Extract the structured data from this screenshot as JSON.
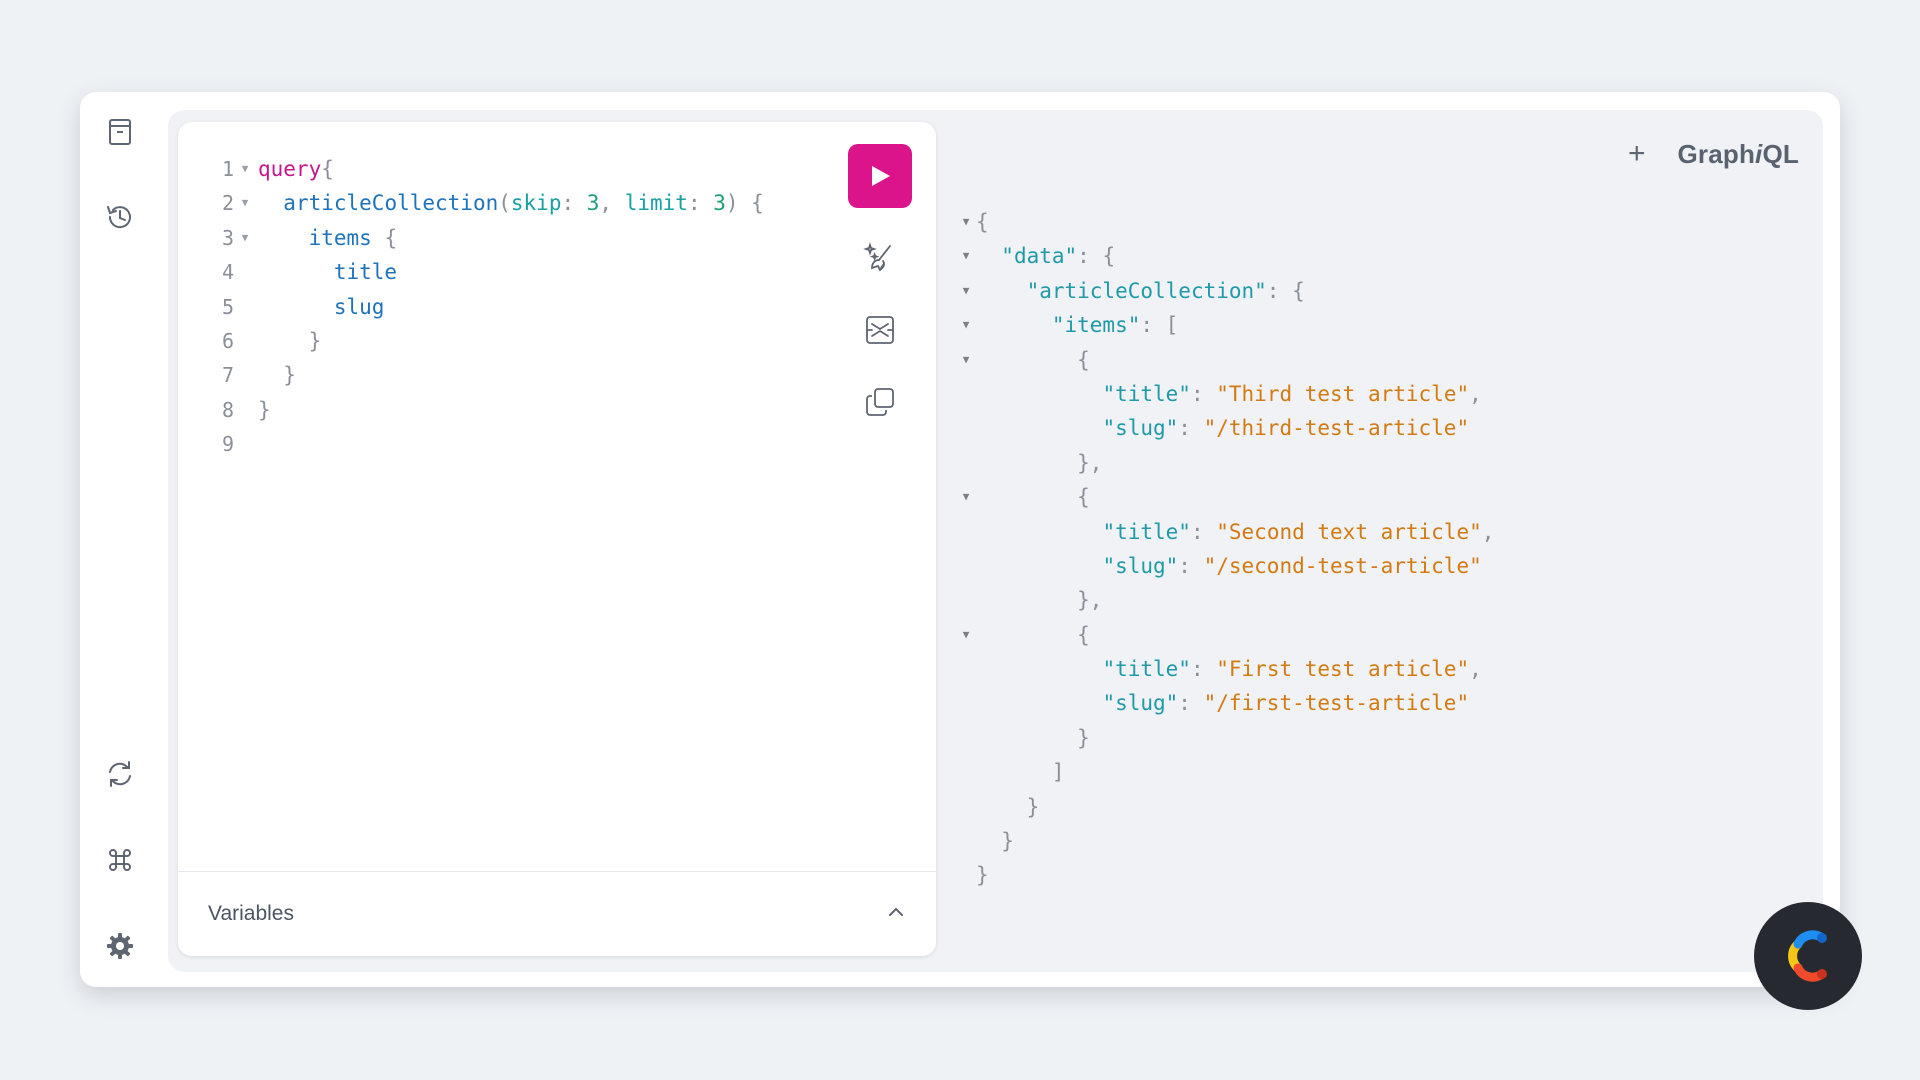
{
  "app": {
    "logo_prefix": "Graph",
    "logo_italic": "i",
    "logo_suffix": "QL",
    "add_tab_label": "+"
  },
  "editor": {
    "lines": [
      {
        "n": "1",
        "fold": true,
        "tokens": [
          [
            "kw",
            "query"
          ],
          [
            "pn",
            "{"
          ]
        ]
      },
      {
        "n": "2",
        "fold": true,
        "tokens": [
          [
            "sp",
            "  "
          ],
          [
            "fn",
            "articleCollection"
          ],
          [
            "pn",
            "("
          ],
          [
            "arg",
            "skip"
          ],
          [
            "pn",
            ": "
          ],
          [
            "num",
            "3"
          ],
          [
            "pn",
            ", "
          ],
          [
            "arg",
            "limit"
          ],
          [
            "pn",
            ": "
          ],
          [
            "num",
            "3"
          ],
          [
            "pn",
            ") {"
          ]
        ]
      },
      {
        "n": "3",
        "fold": true,
        "tokens": [
          [
            "sp",
            "    "
          ],
          [
            "field",
            "items"
          ],
          [
            "pn",
            " {"
          ]
        ]
      },
      {
        "n": "4",
        "fold": false,
        "tokens": [
          [
            "sp",
            "      "
          ],
          [
            "field",
            "title"
          ]
        ]
      },
      {
        "n": "5",
        "fold": false,
        "tokens": [
          [
            "sp",
            "      "
          ],
          [
            "field",
            "slug"
          ]
        ]
      },
      {
        "n": "6",
        "fold": false,
        "tokens": [
          [
            "sp",
            "    "
          ],
          [
            "pn",
            "}"
          ]
        ]
      },
      {
        "n": "7",
        "fold": false,
        "tokens": [
          [
            "sp",
            "  "
          ],
          [
            "pn",
            "}"
          ]
        ]
      },
      {
        "n": "8",
        "fold": false,
        "tokens": [
          [
            "pn",
            "}"
          ]
        ]
      },
      {
        "n": "9",
        "fold": false,
        "tokens": []
      }
    ],
    "variables_label": "Variables"
  },
  "result": {
    "lines": [
      {
        "fold": true,
        "tokens": [
          [
            "rp",
            "{"
          ]
        ]
      },
      {
        "fold": true,
        "tokens": [
          [
            "sp",
            "  "
          ],
          [
            "key",
            "\"data\""
          ],
          [
            "rp",
            ": {"
          ]
        ]
      },
      {
        "fold": true,
        "tokens": [
          [
            "sp",
            "    "
          ],
          [
            "key",
            "\"articleCollection\""
          ],
          [
            "rp",
            ": {"
          ]
        ]
      },
      {
        "fold": true,
        "tokens": [
          [
            "sp",
            "      "
          ],
          [
            "key",
            "\"items\""
          ],
          [
            "rp",
            ": ["
          ]
        ]
      },
      {
        "fold": true,
        "tokens": [
          [
            "sp",
            "        "
          ],
          [
            "rp",
            "{"
          ]
        ]
      },
      {
        "fold": false,
        "tokens": [
          [
            "sp",
            "          "
          ],
          [
            "key",
            "\"title\""
          ],
          [
            "rp",
            ": "
          ],
          [
            "str",
            "\"Third test article\""
          ],
          [
            "rp",
            ","
          ]
        ]
      },
      {
        "fold": false,
        "tokens": [
          [
            "sp",
            "          "
          ],
          [
            "key",
            "\"slug\""
          ],
          [
            "rp",
            ": "
          ],
          [
            "str",
            "\"/third-test-article\""
          ]
        ]
      },
      {
        "fold": false,
        "tokens": [
          [
            "sp",
            "        "
          ],
          [
            "rp",
            "},"
          ]
        ]
      },
      {
        "fold": true,
        "tokens": [
          [
            "sp",
            "        "
          ],
          [
            "rp",
            "{"
          ]
        ]
      },
      {
        "fold": false,
        "tokens": [
          [
            "sp",
            "          "
          ],
          [
            "key",
            "\"title\""
          ],
          [
            "rp",
            ": "
          ],
          [
            "str",
            "\"Second text article\""
          ],
          [
            "rp",
            ","
          ]
        ]
      },
      {
        "fold": false,
        "tokens": [
          [
            "sp",
            "          "
          ],
          [
            "key",
            "\"slug\""
          ],
          [
            "rp",
            ": "
          ],
          [
            "str",
            "\"/second-test-article\""
          ]
        ]
      },
      {
        "fold": false,
        "tokens": [
          [
            "sp",
            "        "
          ],
          [
            "rp",
            "},"
          ]
        ]
      },
      {
        "fold": true,
        "tokens": [
          [
            "sp",
            "        "
          ],
          [
            "rp",
            "{"
          ]
        ]
      },
      {
        "fold": false,
        "tokens": [
          [
            "sp",
            "          "
          ],
          [
            "key",
            "\"title\""
          ],
          [
            "rp",
            ": "
          ],
          [
            "str",
            "\"First test article\""
          ],
          [
            "rp",
            ","
          ]
        ]
      },
      {
        "fold": false,
        "tokens": [
          [
            "sp",
            "          "
          ],
          [
            "key",
            "\"slug\""
          ],
          [
            "rp",
            ": "
          ],
          [
            "str",
            "\"/first-test-article\""
          ]
        ]
      },
      {
        "fold": false,
        "tokens": [
          [
            "sp",
            "        "
          ],
          [
            "rp",
            "}"
          ]
        ]
      },
      {
        "fold": false,
        "tokens": [
          [
            "sp",
            "      "
          ],
          [
            "rp",
            "]"
          ]
        ]
      },
      {
        "fold": false,
        "tokens": [
          [
            "sp",
            "    "
          ],
          [
            "rp",
            "}"
          ]
        ]
      },
      {
        "fold": false,
        "tokens": [
          [
            "sp",
            "  "
          ],
          [
            "rp",
            "}"
          ]
        ]
      },
      {
        "fold": false,
        "tokens": [
          [
            "rp",
            "}"
          ]
        ]
      }
    ]
  },
  "sidebar": {
    "top_icons": [
      "docs-icon",
      "history-icon"
    ],
    "bottom_icons": [
      "refetch-schema-icon",
      "shortcuts-icon",
      "settings-icon"
    ]
  },
  "toolbar": {
    "icons": [
      "run-icon",
      "prettify-icon",
      "merge-fragments-icon",
      "copy-icon"
    ]
  },
  "colors": {
    "accent": "#dc148c",
    "keyword": "#c5168c",
    "field": "#1e73bd",
    "json_key": "#1e9aa8",
    "json_string": "#d37a10",
    "punctuation": "#8a8f98",
    "badge_bg": "#262a30"
  }
}
